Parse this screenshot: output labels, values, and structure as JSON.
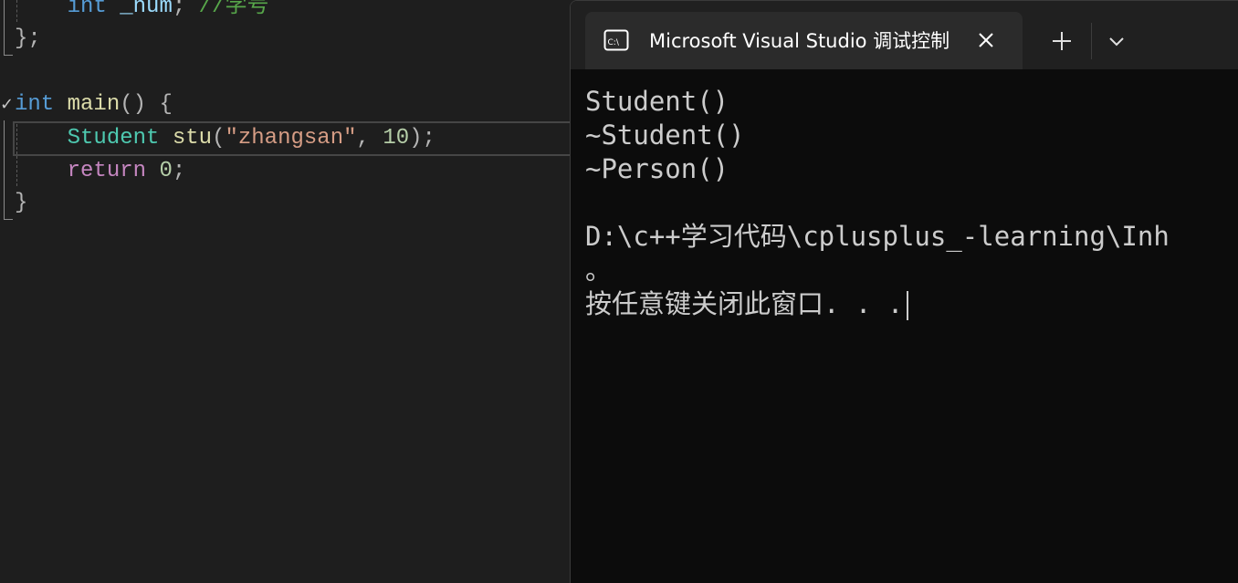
{
  "editor": {
    "lines": {
      "l1": {
        "type": "int",
        "name": "_num",
        "semi": ";",
        "comment": "//学号"
      },
      "l2": {
        "brace": "}",
        "semi": ";"
      },
      "l3": {
        "type": "int",
        "fn": "main",
        "parens": "()",
        "brace": "{"
      },
      "l4": {
        "cls": "Student",
        "var": "stu",
        "open": "(",
        "str": "\"zhangsan\"",
        "comma": ",",
        "num": "10",
        "close": ")",
        "semi": ";"
      },
      "l5": {
        "kw": "return",
        "num": "0",
        "semi": ";"
      },
      "l6": {
        "brace": "}"
      }
    },
    "fold_mark": "✓"
  },
  "terminal": {
    "tab_title": "Microsoft Visual Studio 调试控制台",
    "icons": {
      "tab": "console-icon",
      "close": "close-icon",
      "new_tab": "plus-icon",
      "dropdown": "chevron-down-icon"
    },
    "output": [
      "Student()",
      "~Student()",
      "~Person()",
      "",
      "D:\\c++学习代码\\cplusplus_-learning\\Inh",
      "。",
      "按任意键关闭此窗口. . ."
    ]
  }
}
